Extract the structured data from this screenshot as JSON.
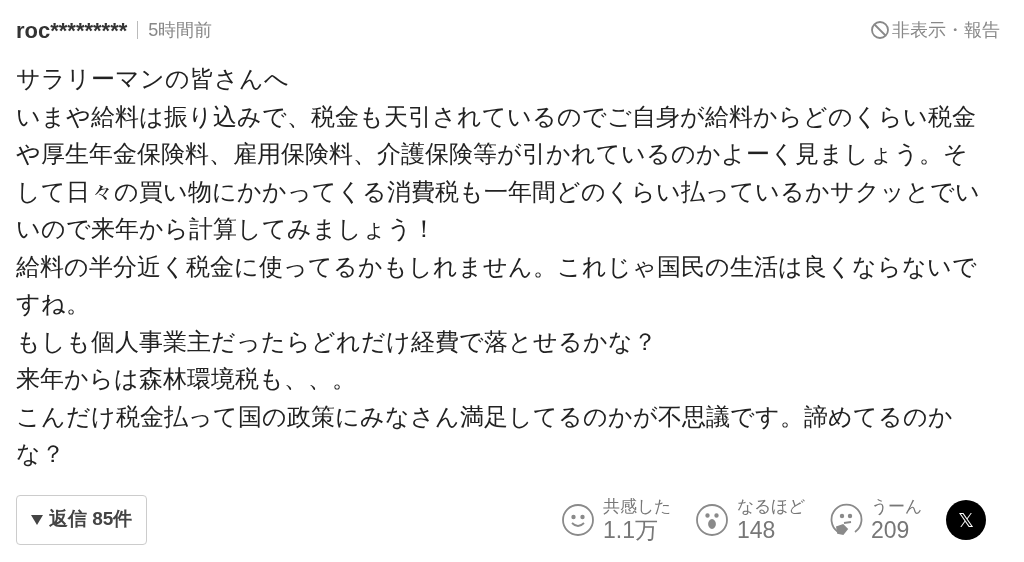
{
  "header": {
    "user": "roc*********",
    "time": "5時間前",
    "hide_report": "非表示・報告"
  },
  "body_lines": [
    "サラリーマンの皆さんへ",
    "いまや給料は振り込みで、税金も天引されているのでご自身が給料からどのくらい税金",
    "や厚生年金保険料、雇用保険料、介護保険等が引かれているのかよーく見ましょう。そ",
    "して日々の買い物にかかってくる消費税も一年間どのくらい払っているかサクッとでい",
    "いので来年から計算してみましょう！",
    "給料の半分近く税金に使ってるかもしれません。これじゃ国民の生活は良くならないで",
    "すね。",
    "もしも個人事業主だったらどれだけ経費で落とせるかな？",
    "来年からは森林環境税も、、。",
    "こんだけ税金払って国の政策にみなさん満足してるのかが不思議です。諦めてるのか",
    "な？"
  ],
  "replies": {
    "label": "返信 85件",
    "expanded": false
  },
  "reactions": [
    {
      "kind": "smile",
      "label": "共感した",
      "count": "1.1万"
    },
    {
      "kind": "surprise",
      "label": "なるほど",
      "count": "148"
    },
    {
      "kind": "think",
      "label": "うーん",
      "count": "209"
    }
  ],
  "share": {
    "label": "𝕏"
  }
}
